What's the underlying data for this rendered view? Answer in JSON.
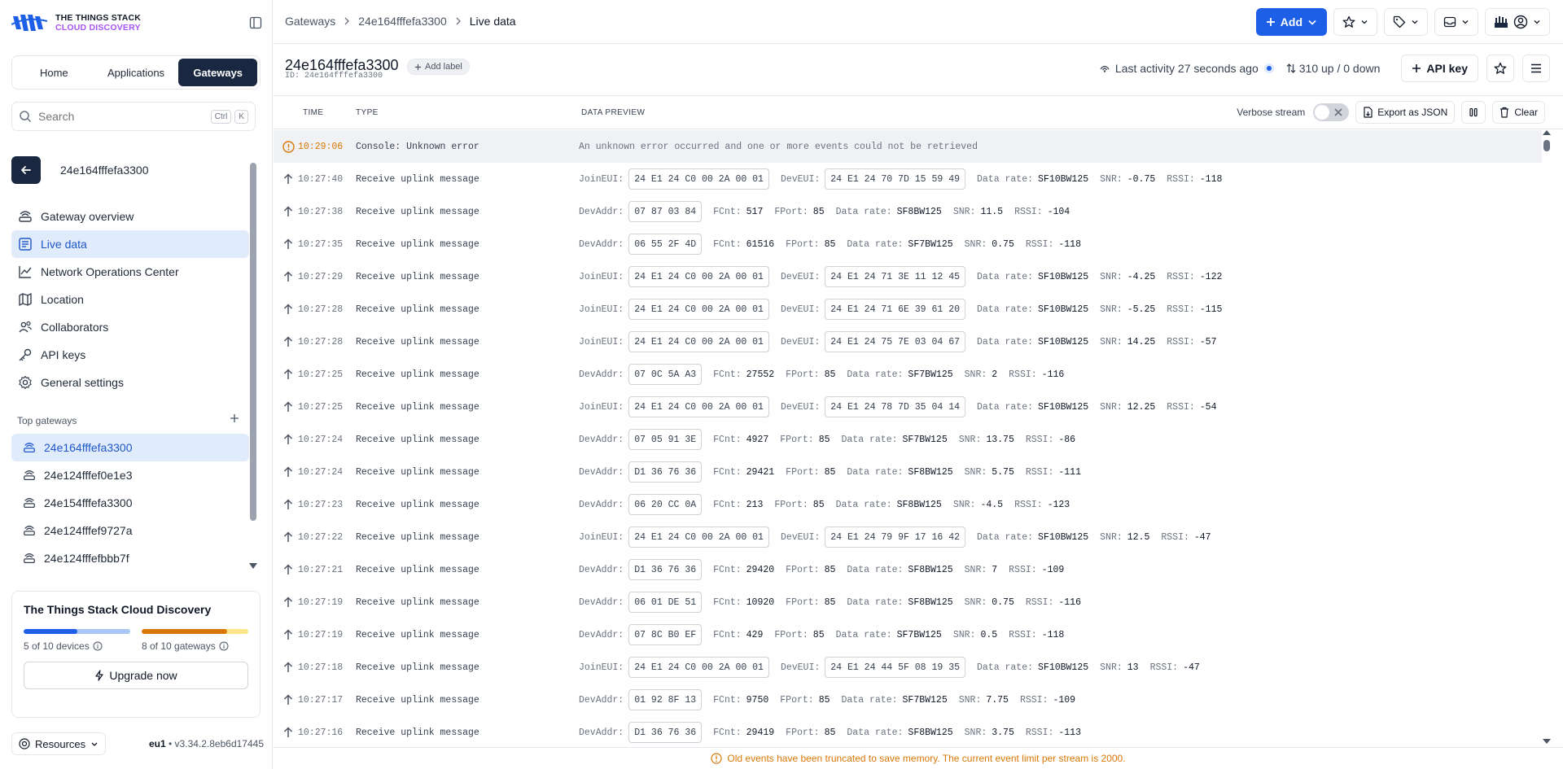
{
  "brand": {
    "line1": "THE THINGS STACK",
    "line2": "CLOUD DISCOVERY"
  },
  "main_tabs": [
    {
      "label": "Home",
      "active": false
    },
    {
      "label": "Applications",
      "active": false
    },
    {
      "label": "Gateways",
      "active": true
    }
  ],
  "search": {
    "placeholder": "Search",
    "kbd1": "Ctrl",
    "kbd2": "K"
  },
  "entity": {
    "name": "24e164fffefa3300"
  },
  "nav": [
    {
      "label": "Gateway overview",
      "icon": "gateway-icon",
      "active": false
    },
    {
      "label": "Live data",
      "icon": "list-icon",
      "active": true
    },
    {
      "label": "Network Operations Center",
      "icon": "chart-icon",
      "active": false
    },
    {
      "label": "Location",
      "icon": "map-icon",
      "active": false
    },
    {
      "label": "Collaborators",
      "icon": "users-icon",
      "active": false
    },
    {
      "label": "API keys",
      "icon": "key-icon",
      "active": false
    },
    {
      "label": "General settings",
      "icon": "gear-icon",
      "active": false
    }
  ],
  "top_gateways": {
    "title": "Top gateways",
    "items": [
      {
        "label": "24e164fffefa3300",
        "active": true
      },
      {
        "label": "24e124fffef0e1e3",
        "active": false
      },
      {
        "label": "24e154fffefa3300",
        "active": false
      },
      {
        "label": "24e124fffef9727a",
        "active": false
      },
      {
        "label": "24e124fffefbbb7f",
        "active": false
      }
    ]
  },
  "plan": {
    "title": "The Things Stack Cloud Discovery",
    "devices_label": "5 of 10 devices",
    "devices_fraction": 0.5,
    "gateways_label": "8 of 10 gateways",
    "gateways_fraction": 0.8,
    "upgrade_label": "Upgrade now",
    "colors": {
      "devices": "#1d5fe6",
      "devices_track": "#a9c6f5",
      "gateways": "#d97706",
      "gateways_track": "#fde68a"
    }
  },
  "footer": {
    "resources_label": "Resources",
    "region": "eu1",
    "version": " • v3.34.2.8eb6d17445"
  },
  "breadcrumb": {
    "items": [
      "Gateways",
      "24e164fffefa3300"
    ],
    "current": "Live data"
  },
  "header": {
    "add_label": "Add"
  },
  "entity_bar": {
    "title": "24e164fffefa3300",
    "id_line": "ID: 24e164fffefa3300",
    "add_label": "Add label",
    "activity": "Last activity 27 seconds ago",
    "updown": "310 up / 0 down",
    "api_key_label": "API key"
  },
  "table": {
    "columns": {
      "time": "TIME",
      "type": "TYPE",
      "preview": "DATA PREVIEW"
    },
    "verbose_label": "Verbose stream",
    "export_label": "Export as JSON",
    "clear_label": "Clear"
  },
  "events": [
    {
      "kind": "error",
      "time": "10:29:06",
      "type": "Console: Unknown error",
      "message": "An unknown error occurred and one or more events could not be retrieved"
    },
    {
      "kind": "join",
      "time": "10:27:40",
      "type": "Receive uplink message",
      "join_eui": "24 E1 24 C0 00 2A 00 01",
      "dev_eui": "24 E1 24 70 7D 15 59 49",
      "data_rate": "SF10BW125",
      "snr": "-0.75",
      "rssi": "-118"
    },
    {
      "kind": "data",
      "time": "10:27:38",
      "type": "Receive uplink message",
      "dev_addr": "07 87 03 84",
      "fcnt": "517",
      "fport": "85",
      "data_rate": "SF8BW125",
      "snr": "11.5",
      "rssi": "-104"
    },
    {
      "kind": "data",
      "time": "10:27:35",
      "type": "Receive uplink message",
      "dev_addr": "06 55 2F 4D",
      "fcnt": "61516",
      "fport": "85",
      "data_rate": "SF7BW125",
      "snr": "0.75",
      "rssi": "-118"
    },
    {
      "kind": "join",
      "time": "10:27:29",
      "type": "Receive uplink message",
      "join_eui": "24 E1 24 C0 00 2A 00 01",
      "dev_eui": "24 E1 24 71 3E 11 12 45",
      "data_rate": "SF10BW125",
      "snr": "-4.25",
      "rssi": "-122"
    },
    {
      "kind": "join",
      "time": "10:27:28",
      "type": "Receive uplink message",
      "join_eui": "24 E1 24 C0 00 2A 00 01",
      "dev_eui": "24 E1 24 71 6E 39 61 20",
      "data_rate": "SF10BW125",
      "snr": "-5.25",
      "rssi": "-115"
    },
    {
      "kind": "join",
      "time": "10:27:28",
      "type": "Receive uplink message",
      "join_eui": "24 E1 24 C0 00 2A 00 01",
      "dev_eui": "24 E1 24 75 7E 03 04 67",
      "data_rate": "SF10BW125",
      "snr": "14.25",
      "rssi": "-57"
    },
    {
      "kind": "data",
      "time": "10:27:25",
      "type": "Receive uplink message",
      "dev_addr": "07 0C 5A A3",
      "fcnt": "27552",
      "fport": "85",
      "data_rate": "SF7BW125",
      "snr": "2",
      "rssi": "-116"
    },
    {
      "kind": "join",
      "time": "10:27:25",
      "type": "Receive uplink message",
      "join_eui": "24 E1 24 C0 00 2A 00 01",
      "dev_eui": "24 E1 24 78 7D 35 04 14",
      "data_rate": "SF10BW125",
      "snr": "12.25",
      "rssi": "-54"
    },
    {
      "kind": "data",
      "time": "10:27:24",
      "type": "Receive uplink message",
      "dev_addr": "07 05 91 3E",
      "fcnt": "4927",
      "fport": "85",
      "data_rate": "SF7BW125",
      "snr": "13.75",
      "rssi": "-86"
    },
    {
      "kind": "data",
      "time": "10:27:24",
      "type": "Receive uplink message",
      "dev_addr": "D1 36 76 36",
      "fcnt": "29421",
      "fport": "85",
      "data_rate": "SF8BW125",
      "snr": "5.75",
      "rssi": "-111"
    },
    {
      "kind": "data",
      "time": "10:27:23",
      "type": "Receive uplink message",
      "dev_addr": "06 20 CC 0A",
      "fcnt": "213",
      "fport": "85",
      "data_rate": "SF8BW125",
      "snr": "-4.5",
      "rssi": "-123"
    },
    {
      "kind": "join",
      "time": "10:27:22",
      "type": "Receive uplink message",
      "join_eui": "24 E1 24 C0 00 2A 00 01",
      "dev_eui": "24 E1 24 79 9F 17 16 42",
      "data_rate": "SF10BW125",
      "snr": "12.5",
      "rssi": "-47"
    },
    {
      "kind": "data",
      "time": "10:27:21",
      "type": "Receive uplink message",
      "dev_addr": "D1 36 76 36",
      "fcnt": "29420",
      "fport": "85",
      "data_rate": "SF8BW125",
      "snr": "7",
      "rssi": "-109"
    },
    {
      "kind": "data",
      "time": "10:27:19",
      "type": "Receive uplink message",
      "dev_addr": "06 01 DE 51",
      "fcnt": "10920",
      "fport": "85",
      "data_rate": "SF8BW125",
      "snr": "0.75",
      "rssi": "-116"
    },
    {
      "kind": "data",
      "time": "10:27:19",
      "type": "Receive uplink message",
      "dev_addr": "07 8C B0 EF",
      "fcnt": "429",
      "fport": "85",
      "data_rate": "SF7BW125",
      "snr": "0.5",
      "rssi": "-118"
    },
    {
      "kind": "join",
      "time": "10:27:18",
      "type": "Receive uplink message",
      "join_eui": "24 E1 24 C0 00 2A 00 01",
      "dev_eui": "24 E1 24 44 5F 08 19 35",
      "data_rate": "SF10BW125",
      "snr": "13",
      "rssi": "-47"
    },
    {
      "kind": "data",
      "time": "10:27:17",
      "type": "Receive uplink message",
      "dev_addr": "01 92 8F 13",
      "fcnt": "9750",
      "fport": "85",
      "data_rate": "SF7BW125",
      "snr": "7.75",
      "rssi": "-109"
    },
    {
      "kind": "data",
      "time": "10:27:16",
      "type": "Receive uplink message",
      "dev_addr": "D1 36 76 36",
      "fcnt": "29419",
      "fport": "85",
      "data_rate": "SF8BW125",
      "snr": "3.75",
      "rssi": "-113"
    }
  ],
  "preview_labels": {
    "join_eui": "JoinEUI:",
    "dev_eui": "DevEUI:",
    "dev_addr": "DevAddr:",
    "fcnt": "FCnt:",
    "fport": "FPort:",
    "data_rate": "Data rate:",
    "snr": "SNR:",
    "rssi": "RSSI:"
  },
  "banner": {
    "text": "Old events have been truncated to save memory. The current event limit per stream is 2000."
  }
}
